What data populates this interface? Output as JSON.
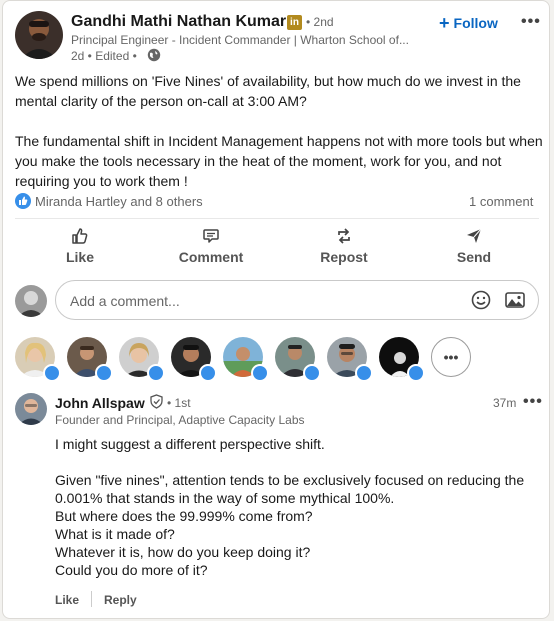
{
  "author": {
    "name": "Gandhi Mathi Nathan Kumar",
    "degree": "• 2nd",
    "headline": "Principal Engineer - Incident Commander | Wharton School of...",
    "time": "2d • Edited •",
    "follow_label": "Follow",
    "badge_text": "in"
  },
  "post": {
    "paragraph1": "We spend millions on 'Five Nines' of availability, but how much do we invest in the mental clarity of the person on-call at 3:00 AM?",
    "paragraph2": "The fundamental shift in Incident Management happens not with more tools but when you make the tools necessary in the heat of the moment, work for you, and not requiring you to work them !"
  },
  "social": {
    "reactors": "Miranda Hartley and 8 others",
    "comments": "1 comment"
  },
  "actions": {
    "like": "Like",
    "comment": "Comment",
    "repost": "Repost",
    "send": "Send"
  },
  "comment_input": {
    "placeholder": "Add a comment..."
  },
  "comment": {
    "name": "John Allspaw",
    "degree": "• 1st",
    "time": "37m",
    "headline": "Founder and Principal, Adaptive Capacity Labs",
    "lines": [
      "I might suggest a different perspective shift.",
      "",
      "Given \"five nines\", attention tends to be exclusively focused on reducing the 0.001% that stands in the way of some mythical 100%.",
      "But where does the 99.999% come from?",
      "What is it made of?",
      "Whatever it is, how do you keep doing it?",
      "Could you do more of it?"
    ],
    "like_label": "Like",
    "reply_label": "Reply"
  },
  "colors": {
    "accent": "#0a66c2",
    "like_blue": "#378fe9",
    "premium_gold": "#b28a1e"
  },
  "icons": [
    "globe-icon",
    "like-icon",
    "comment-icon",
    "repost-icon",
    "send-icon",
    "emoji-icon",
    "image-icon",
    "verified-icon",
    "more-icon"
  ]
}
